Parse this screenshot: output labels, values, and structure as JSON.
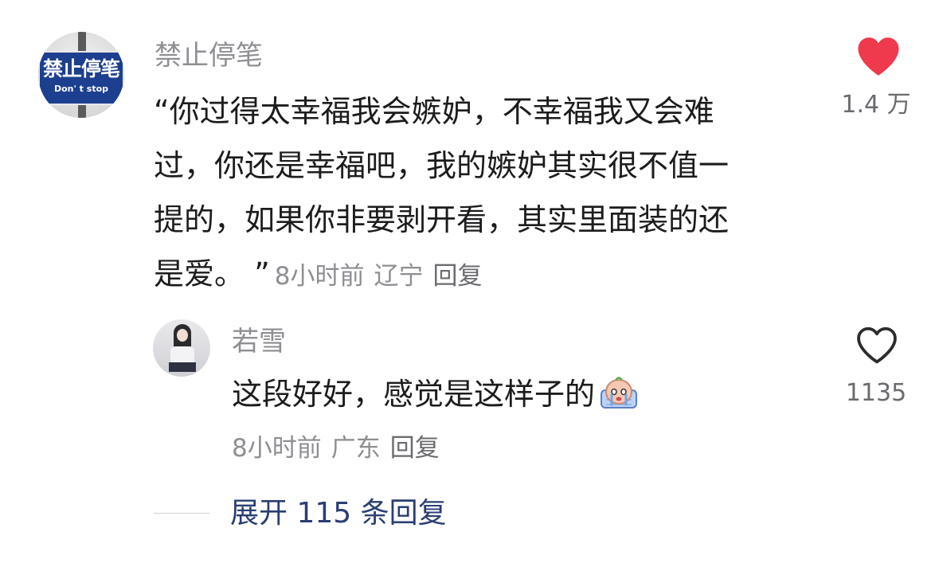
{
  "main_comment": {
    "avatar_sign": {
      "title": "禁止停笔",
      "subtitle": "Don' t stop"
    },
    "username": "禁止停笔",
    "lines": [
      "“你过得太幸福我会嫉妒，不幸福我又会难",
      "过，你还是幸福吧，我的嫉妒其实很不值一",
      "提的，如果你非要剥开看，其实里面装的还",
      "是爱。 ”"
    ],
    "time": "8小时前",
    "location": "辽宁",
    "reply_label": "回复",
    "like_icon": "heart-filled-icon",
    "like_color": "#ee3a4c",
    "like_count": "1.4 万"
  },
  "reply_comment": {
    "username": "若雪",
    "text": "这段好好，感觉是这样子的",
    "emoji": "crying-face-emoji",
    "time": "8小时前",
    "location": "广东",
    "reply_label": "回复",
    "like_icon": "heart-outline-icon",
    "like_count": "1135"
  },
  "expand": {
    "label": "展开 115 条回复",
    "color": "#2b3e73"
  }
}
